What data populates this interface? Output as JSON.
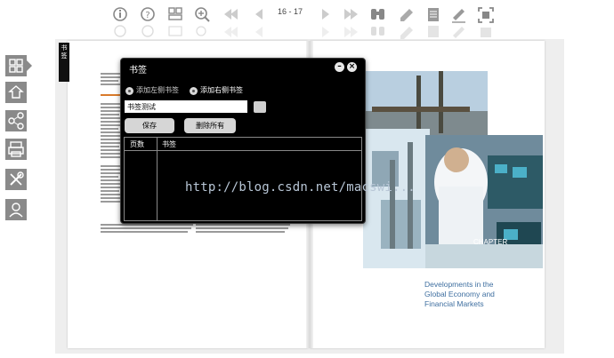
{
  "toolbar": {
    "icons": [
      "info-icon",
      "help-icon",
      "thumbnails-icon",
      "zoom-in-icon",
      "first-page-icon",
      "prev-page-icon",
      "next-page-icon",
      "last-page-icon",
      "binoculars-icon",
      "edit-icon",
      "document-icon",
      "pen-icon",
      "fullscreen-icon"
    ],
    "page_indicator": "16 - 17"
  },
  "left_rail": {
    "icons": [
      "layout-icon",
      "share-icon",
      "network-icon",
      "print-icon",
      "tools-icon",
      "user-icon"
    ]
  },
  "bookmark_tab": {
    "label": "书\n签"
  },
  "dialog": {
    "title": "书签",
    "option_left": "添加左侧书签",
    "option_right": "添加右侧书签",
    "input_value": "书签测试",
    "save_label": "保存",
    "delete_all_label": "删除所有",
    "col_page": "页数",
    "col_bookmark": "书签"
  },
  "book": {
    "chapter_lines": [
      "Developments in the",
      "Global Economy and",
      "Financial Markets"
    ],
    "chapter_label": "CHAPTER"
  },
  "watermark": "http://blog.csdn.net/macswi...",
  "colors": {
    "chapter_title": "#3f6fa0",
    "dialog_bg": "#000000",
    "rail_bg": "#8a8a8a"
  }
}
